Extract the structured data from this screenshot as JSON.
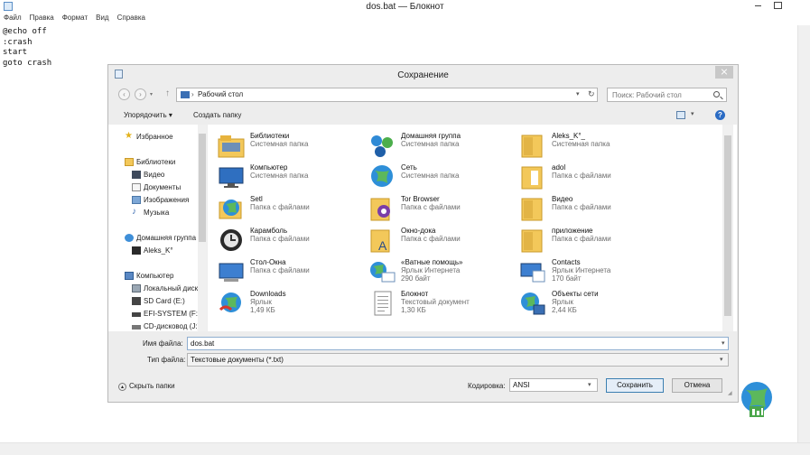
{
  "notepad": {
    "title": "dos.bat — Блокнот",
    "menu": [
      "Файл",
      "Правка",
      "Формат",
      "Вид",
      "Справка"
    ],
    "lines": [
      "@echo off",
      ":crash",
      "start",
      "goto crash"
    ]
  },
  "dialog": {
    "title": "Сохранение",
    "address": "Рабочий стол",
    "search_placeholder": "Поиск: Рабочий стол",
    "toolbar": {
      "organize": "Упорядочить ▾",
      "new_folder": "Создать папку",
      "help": "?"
    },
    "nav": {
      "favorites": "Избранное",
      "libraries": "Библиотеки",
      "library_items": [
        "Видео",
        "Документы",
        "Изображения",
        "Музыка"
      ],
      "homegroup": "Домашняя группа",
      "homegroup_user": "Aleks_K°",
      "computer": "Компьютер",
      "computer_items": [
        "Локальный диск",
        "SD Card (E:)",
        "EFI-SYSTEM (F:)",
        "CD-дисковод (J:)"
      ]
    },
    "files": [
      {
        "name": "Библиотеки",
        "type": "Системная папка",
        "size": ""
      },
      {
        "name": "Домашняя группа",
        "type": "Системная папка",
        "size": ""
      },
      {
        "name": "Aleks_K°_",
        "type": "Системная папка",
        "size": ""
      },
      {
        "name": "Компьютер",
        "type": "Системная папка",
        "size": ""
      },
      {
        "name": "Сеть",
        "type": "Системная папка",
        "size": ""
      },
      {
        "name": "adol",
        "type": "Папка с файлами",
        "size": ""
      },
      {
        "name": "Setl",
        "type": "Папка с файлами",
        "size": ""
      },
      {
        "name": "Tor Browser",
        "type": "Папка с файлами",
        "size": ""
      },
      {
        "name": "Видео",
        "type": "Папка с файлами",
        "size": ""
      },
      {
        "name": "Карамболь",
        "type": "Папка с файлами",
        "size": ""
      },
      {
        "name": "Окно-дока",
        "type": "Папка с файлами",
        "size": ""
      },
      {
        "name": "приложение",
        "type": "Папка с файлами",
        "size": ""
      },
      {
        "name": "Стол-Окна",
        "type": "Папка с файлами",
        "size": ""
      },
      {
        "name": "«Ватные помощь»",
        "type": "Ярлык Интернета",
        "size": "290 байт"
      },
      {
        "name": "Contacts",
        "type": "Ярлык Интернета",
        "size": "170 байт"
      },
      {
        "name": "Downloads",
        "type": "Ярлык",
        "size": "1,49 КБ"
      },
      {
        "name": "Блокнот",
        "type": "Текстовый документ",
        "size": "1,30 КБ"
      },
      {
        "name": "Объекты сети",
        "type": "Ярлык",
        "size": "2,44 КБ"
      }
    ],
    "filename_label": "Имя файла:",
    "filename_value": "dos.bat",
    "filetype_label": "Тип файла:",
    "filetype_value": "Текстовые документы (*.txt)",
    "hide_folders": "Скрыть папки",
    "encoding_label": "Кодировка:",
    "encoding_value": "ANSI",
    "save": "Сохранить",
    "cancel": "Отмена"
  },
  "colors": {
    "accent": "#3c7fb1",
    "folder": "#f3c85a",
    "help": "#2b6cc4"
  }
}
